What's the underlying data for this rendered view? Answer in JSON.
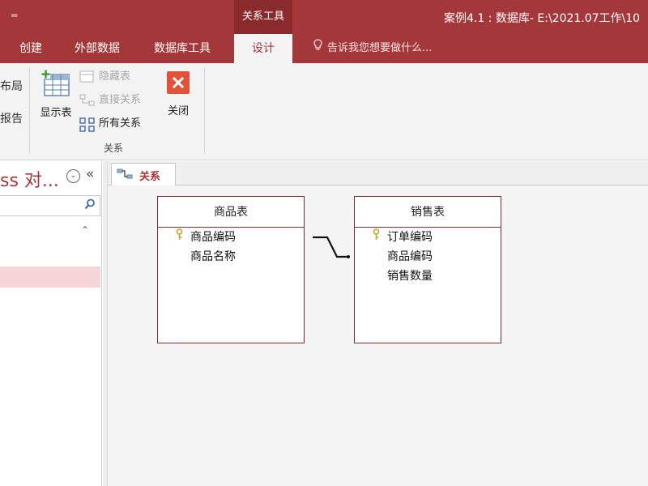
{
  "titlebar": {
    "quick_access": "═",
    "context_tab_header": "关系工具",
    "window_title": "案例4.1 : 数据库- E:\\2021.07工作\\10"
  },
  "tabs": [
    {
      "label": "创建"
    },
    {
      "label": "外部数据"
    },
    {
      "label": "数据库工具"
    },
    {
      "label": "设计"
    }
  ],
  "tell_me": "告诉我您想要做什么...",
  "ribbon": {
    "left_items": [
      "布局",
      "报告"
    ],
    "show_table": "显示表",
    "hide_table": "隐藏表",
    "direct_relationships": "直接关系",
    "all_relationships": "所有关系",
    "close": "关闭",
    "group_label": "关系"
  },
  "nav": {
    "title": "ss 对...",
    "dropdown": "⌄",
    "collapse": "«",
    "section_toggle": "⌃"
  },
  "document": {
    "tab_label": "关系"
  },
  "tables": [
    {
      "name": "商品表",
      "fields": [
        {
          "label": "商品编码",
          "key": true
        },
        {
          "label": "商品名称",
          "key": false
        }
      ]
    },
    {
      "name": "销售表",
      "fields": [
        {
          "label": "订单编码",
          "key": true
        },
        {
          "label": "商品编码",
          "key": false
        },
        {
          "label": "销售数量",
          "key": false
        }
      ]
    }
  ],
  "colors": {
    "accent": "#a4373a",
    "selected_nav": "#f6d5d7"
  },
  "icons": {
    "show_table": "table-icon",
    "close": "close-icon",
    "search": "search-icon",
    "key": "key-icon"
  }
}
